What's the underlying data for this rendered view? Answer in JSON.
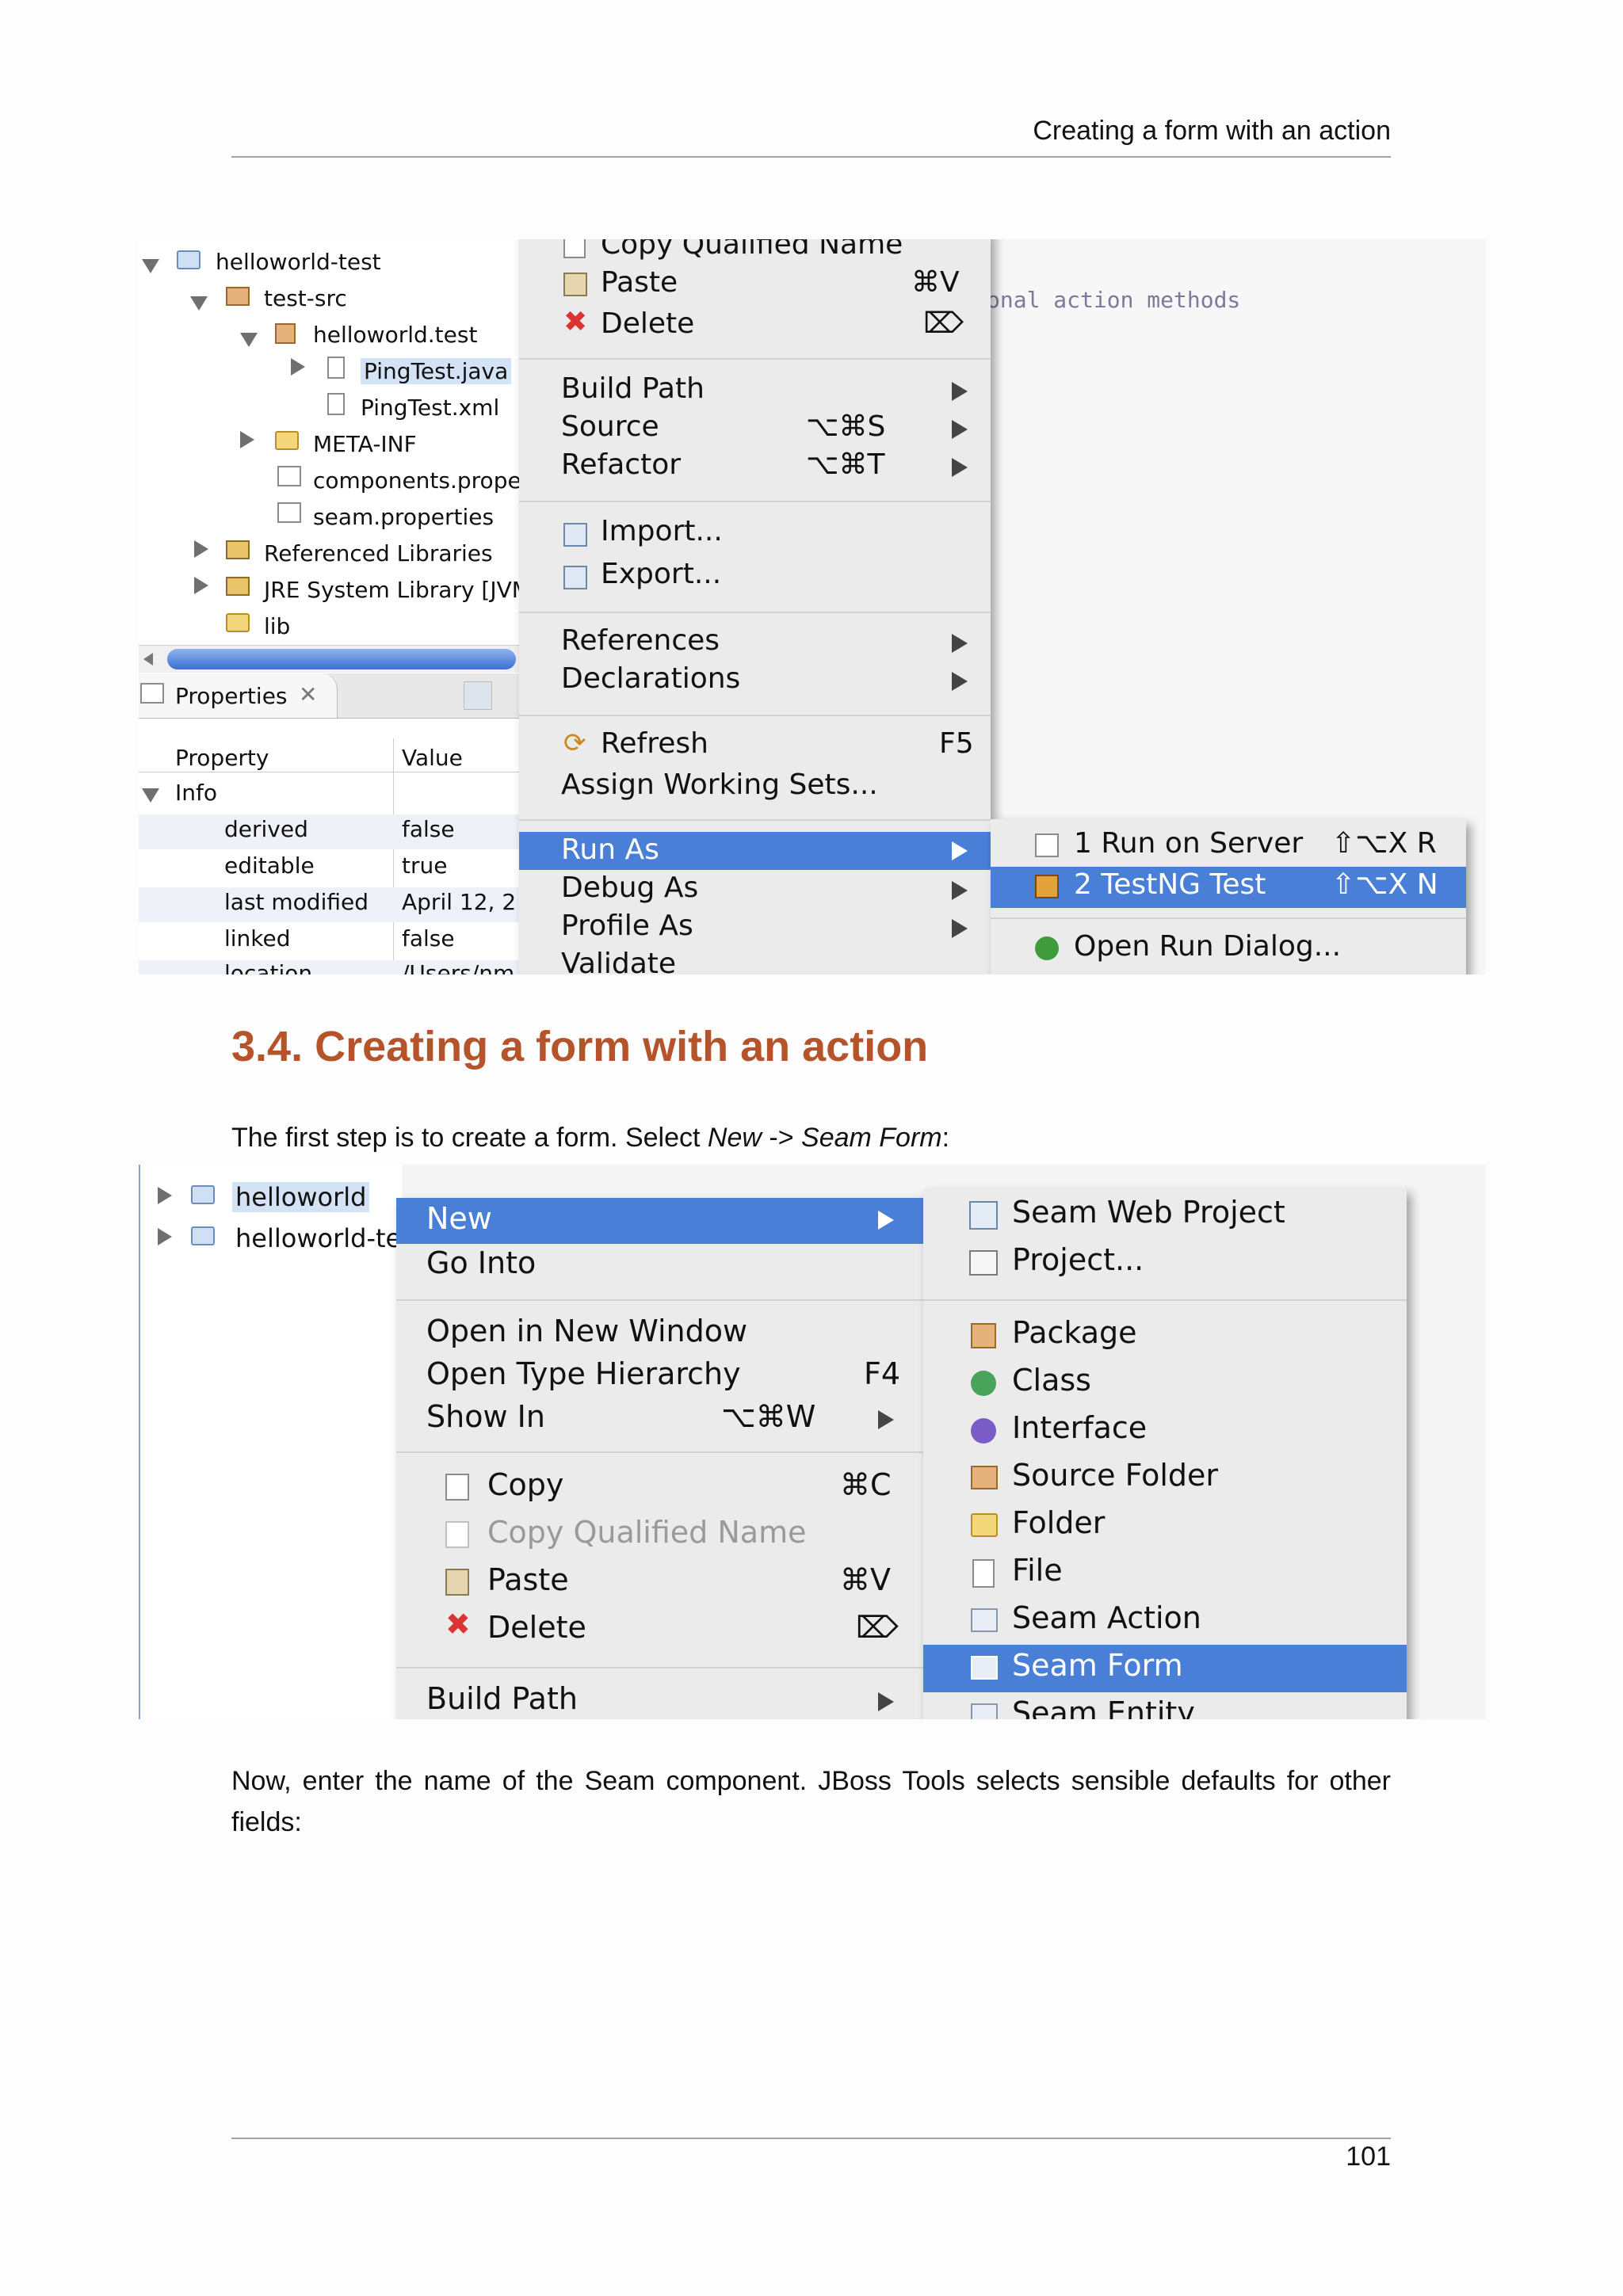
{
  "header": {
    "title": "Creating a form with an action"
  },
  "screenshot1": {
    "tree": [
      "helloworld-test",
      "test-src",
      "helloworld.test",
      "PingTest.java",
      "PingTest.xml",
      "META-INF",
      "components.prope",
      "seam.properties",
      "Referenced Libraries",
      "JRE System Library [JVM",
      "lib"
    ],
    "properties_tab": "Properties",
    "prop_headers": {
      "property": "Property",
      "value": "Value"
    },
    "prop_group": "Info",
    "prop_rows": [
      {
        "name": "derived",
        "value": "false"
      },
      {
        "name": "editable",
        "value": "true"
      },
      {
        "name": "last modified",
        "value": "April 12, 2"
      },
      {
        "name": "linked",
        "value": "false"
      },
      {
        "name": "location",
        "value": "/Users/nm"
      }
    ],
    "editor_text": "onal action methods",
    "menu": [
      {
        "label": "Copy Qualified Name",
        "shortcut": ""
      },
      {
        "label": "Paste",
        "shortcut": "⌘V"
      },
      {
        "label": "Delete",
        "shortcut": "⌦"
      },
      {
        "label": "Build Path",
        "shortcut": ""
      },
      {
        "label": "Source",
        "shortcut": "⌥⌘S"
      },
      {
        "label": "Refactor",
        "shortcut": "⌥⌘T"
      },
      {
        "label": "Import...",
        "shortcut": ""
      },
      {
        "label": "Export...",
        "shortcut": ""
      },
      {
        "label": "References",
        "shortcut": ""
      },
      {
        "label": "Declarations",
        "shortcut": ""
      },
      {
        "label": "Refresh",
        "shortcut": "F5"
      },
      {
        "label": "Assign Working Sets...",
        "shortcut": ""
      },
      {
        "label": "Run As",
        "shortcut": ""
      },
      {
        "label": "Debug As",
        "shortcut": ""
      },
      {
        "label": "Profile As",
        "shortcut": ""
      },
      {
        "label": "Validate",
        "shortcut": ""
      }
    ],
    "submenu": [
      {
        "label": "1 Run on Server",
        "shortcut": "⇧⌥X R"
      },
      {
        "label": "2 TestNG Test",
        "shortcut": "⇧⌥X N"
      },
      {
        "label": "Open Run Dialog...",
        "shortcut": ""
      }
    ]
  },
  "section": {
    "heading": "3.4. Creating a form with an action",
    "intro_prefix": "The first step is to create a form. Select ",
    "intro_new": "New",
    "intro_arrow": " -> ",
    "intro_form": "Seam Form",
    "intro_suffix": ":"
  },
  "screenshot2": {
    "tree": [
      "helloworld",
      "helloworld-te"
    ],
    "menu": [
      {
        "label": "New",
        "shortcut": ""
      },
      {
        "label": "Go Into",
        "shortcut": ""
      },
      {
        "label": "Open in New Window",
        "shortcut": ""
      },
      {
        "label": "Open Type Hierarchy",
        "shortcut": "F4"
      },
      {
        "label": "Show In",
        "shortcut": "⌥⌘W"
      },
      {
        "label": "Copy",
        "shortcut": "⌘C"
      },
      {
        "label": "Copy Qualified Name",
        "shortcut": ""
      },
      {
        "label": "Paste",
        "shortcut": "⌘V"
      },
      {
        "label": "Delete",
        "shortcut": "⌦"
      },
      {
        "label": "Build Path",
        "shortcut": ""
      }
    ],
    "submenu": [
      "Seam Web Project",
      "Project...",
      "Package",
      "Class",
      "Interface",
      "Source Folder",
      "Folder",
      "File",
      "Seam Action",
      "Seam Form",
      "Seam Entity"
    ]
  },
  "paragraph2": "Now, enter the name of the Seam component. JBoss Tools selects sensible defaults for other fields:",
  "footer": {
    "page_number": "101"
  },
  "colors": {
    "accent": "#b5542a",
    "selection": "#4a7fd8"
  }
}
